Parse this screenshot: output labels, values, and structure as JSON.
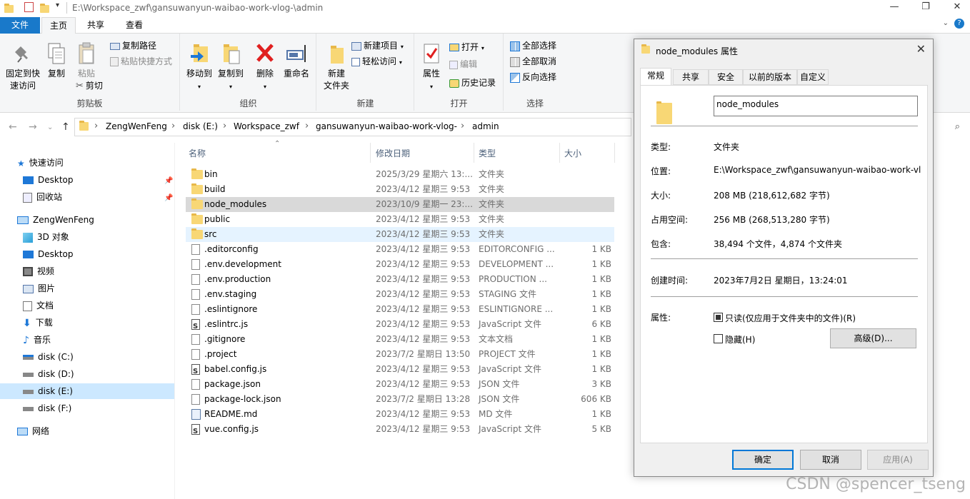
{
  "window": {
    "path": "E:\\Workspace_zwf\\gansuwanyun-waibao-work-vlog-\\admin"
  },
  "ribbon_tabs": [
    "文件",
    "主页",
    "共享",
    "查看"
  ],
  "ribbon": {
    "clipboard": {
      "pin": "固定到快\n速访问",
      "copy": "复制",
      "paste": "粘贴",
      "copy_path": "复制路径",
      "paste_shortcut": "粘贴快捷方式",
      "cut": "剪切",
      "label": "剪贴板"
    },
    "organize": {
      "move_to": "移动到",
      "copy_to": "复制到",
      "delete": "删除",
      "rename": "重命名",
      "label": "组织"
    },
    "new": {
      "new_folder": "新建\n文件夹",
      "new_item": "新建项目",
      "easy_access": "轻松访问",
      "label": "新建"
    },
    "open": {
      "properties": "属性",
      "open": "打开",
      "edit": "编辑",
      "history": "历史记录",
      "label": "打开"
    },
    "select": {
      "select_all": "全部选择",
      "select_none": "全部取消",
      "invert": "反向选择",
      "label": "选择"
    }
  },
  "breadcrumb": [
    "ZengWenFeng",
    "disk (E:)",
    "Workspace_zwf",
    "gansuwanyun-waibao-work-vlog-",
    "admin"
  ],
  "nav": {
    "quick_access": "快速访问",
    "items": [
      "Desktop",
      "回收站",
      "ZengWenFeng",
      "3D 对象",
      "Desktop",
      "视频",
      "图片",
      "文档",
      "下载",
      "音乐",
      "disk (C:)",
      "disk (D:)",
      "disk (E:)",
      "disk (F:)",
      "网络"
    ]
  },
  "columns": {
    "name": "名称",
    "date": "修改日期",
    "type": "类型",
    "size": "大小"
  },
  "files": [
    {
      "name": "bin",
      "date": "2025/3/29 星期六 13:...",
      "type": "文件夹",
      "size": "",
      "icon": "folder"
    },
    {
      "name": "build",
      "date": "2023/4/12 星期三 9:53",
      "type": "文件夹",
      "size": "",
      "icon": "folder"
    },
    {
      "name": "node_modules",
      "date": "2023/10/9 星期一 23:...",
      "type": "文件夹",
      "size": "",
      "icon": "folder"
    },
    {
      "name": "public",
      "date": "2023/4/12 星期三 9:53",
      "type": "文件夹",
      "size": "",
      "icon": "folder"
    },
    {
      "name": "src",
      "date": "2023/4/12 星期三 9:53",
      "type": "文件夹",
      "size": "",
      "icon": "folder"
    },
    {
      "name": ".editorconfig",
      "date": "2023/4/12 星期三 9:53",
      "type": "EDITORCONFIG ...",
      "size": "1 KB",
      "icon": "file"
    },
    {
      "name": ".env.development",
      "date": "2023/4/12 星期三 9:53",
      "type": "DEVELOPMENT ...",
      "size": "1 KB",
      "icon": "file"
    },
    {
      "name": ".env.production",
      "date": "2023/4/12 星期三 9:53",
      "type": "PRODUCTION ...",
      "size": "1 KB",
      "icon": "file"
    },
    {
      "name": ".env.staging",
      "date": "2023/4/12 星期三 9:53",
      "type": "STAGING 文件",
      "size": "1 KB",
      "icon": "file"
    },
    {
      "name": ".eslintignore",
      "date": "2023/4/12 星期三 9:53",
      "type": "ESLINTIGNORE ...",
      "size": "1 KB",
      "icon": "file"
    },
    {
      "name": ".eslintrc.js",
      "date": "2023/4/12 星期三 9:53",
      "type": "JavaScript 文件",
      "size": "6 KB",
      "icon": "js"
    },
    {
      "name": ".gitignore",
      "date": "2023/4/12 星期三 9:53",
      "type": "文本文档",
      "size": "1 KB",
      "icon": "file"
    },
    {
      "name": ".project",
      "date": "2023/7/2 星期日 13:50",
      "type": "PROJECT 文件",
      "size": "1 KB",
      "icon": "file"
    },
    {
      "name": "babel.config.js",
      "date": "2023/4/12 星期三 9:53",
      "type": "JavaScript 文件",
      "size": "1 KB",
      "icon": "js"
    },
    {
      "name": "package.json",
      "date": "2023/4/12 星期三 9:53",
      "type": "JSON 文件",
      "size": "3 KB",
      "icon": "file"
    },
    {
      "name": "package-lock.json",
      "date": "2023/7/2 星期日 13:28",
      "type": "JSON 文件",
      "size": "606 KB",
      "icon": "file"
    },
    {
      "name": "README.md",
      "date": "2023/4/12 星期三 9:53",
      "type": "MD 文件",
      "size": "1 KB",
      "icon": "md"
    },
    {
      "name": "vue.config.js",
      "date": "2023/4/12 星期三 9:53",
      "type": "JavaScript 文件",
      "size": "5 KB",
      "icon": "js"
    }
  ],
  "dialog": {
    "title": "node_modules 属性",
    "tabs": [
      "常规",
      "共享",
      "安全",
      "以前的版本",
      "自定义"
    ],
    "name_value": "node_modules",
    "type_label": "类型:",
    "type_value": "文件夹",
    "location_label": "位置:",
    "location_value": "E:\\Workspace_zwf\\gansuwanyun-waibao-work-vlog-\\admin",
    "size_label": "大小:",
    "size_value": "208 MB (218,612,682 字节)",
    "disk_label": "占用空间:",
    "disk_value": "256 MB (268,513,280 字节)",
    "contains_label": "包含:",
    "contains_value": "38,494 个文件，4,874 个文件夹",
    "created_label": "创建时间:",
    "created_value": "2023年7月2日 星期日，13:24:01",
    "attr_label": "属性:",
    "readonly": "只读(仅应用于文件夹中的文件)(R)",
    "hidden": "隐藏(H)",
    "advanced": "高级(D)...",
    "ok": "确定",
    "cancel": "取消",
    "apply": "应用(A)"
  },
  "watermark": "CSDN @spencer_tseng",
  "colors": {
    "accent": "#1979ca",
    "selection": "#cce8ff",
    "folder": "#f8d775"
  }
}
